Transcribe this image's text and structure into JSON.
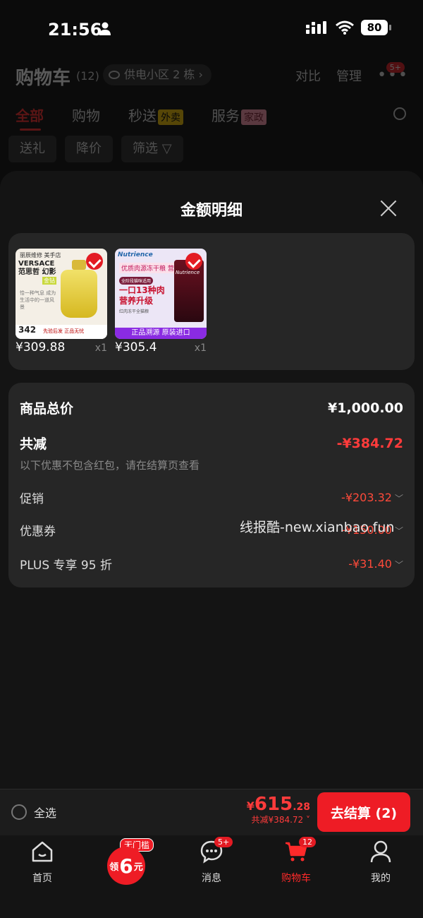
{
  "status": {
    "time": "21:56",
    "battery": "80"
  },
  "header": {
    "title": "购物车",
    "count": "(12)",
    "address": "供电小区 2 栋",
    "compare": "对比",
    "manage": "管理",
    "more_badge": "5+"
  },
  "category_tabs": {
    "all": "全部",
    "shopping": "购物",
    "express": "秒送",
    "express_tag": "外卖",
    "service": "服务",
    "service_tag": "家政"
  },
  "filters": {
    "gift": "送礼",
    "price_drop": "降价",
    "filter": "筛选"
  },
  "sheet": {
    "title": "金额明细",
    "products": [
      {
        "price": "¥309.88",
        "qty": "x1",
        "thumb_shop": "丽辰维修 美手店",
        "thumb_brand": "VERSACE 范思哲 幻影",
        "thumb_green": "金钻",
        "thumb_desc": "恰一种气息 成为生活中的一道风景",
        "thumb_bottom": "342",
        "thumb_bottom_small": "先验后发 正品无忧"
      },
      {
        "price": "¥305.4",
        "qty": "x1",
        "thumb_brand": "Nutrience",
        "thumb_line1": "优质肉源冻干粮 营养升",
        "thumb_mini": "全阶段猫咪适用",
        "thumb_big1": "一口13种肉",
        "thumb_big2": "营养升级",
        "thumb_small": "红肉冻干全猫粮",
        "thumb_bottom": "正品溯源 原装进口"
      }
    ],
    "details": {
      "total_label": "商品总价",
      "total_value": "¥1,000.00",
      "reduce_label": "共减",
      "reduce_value": "-¥384.72",
      "note": "以下优惠不包含红包，请在结算页查看",
      "promo_label": "促销",
      "promo_value": "-¥203.32",
      "coupon_label": "优惠券",
      "coupon_value": "-¥150.00",
      "plus_label": "PLUS 专享 95 折",
      "plus_value": "-¥31.40"
    },
    "watermark": "线报酷-new.xianbao.fun"
  },
  "checkout": {
    "select_all": "全选",
    "currency": "¥",
    "total_int": "615",
    "total_dec": ".28",
    "total_reduce": "共减¥384.72",
    "pay_button": "去结算 (2)"
  },
  "bottom_nav": {
    "home": "首页",
    "coupon_tag": "无门槛",
    "coupon_pre": "领",
    "coupon_num": "6",
    "coupon_post": "元",
    "messages": "消息",
    "messages_badge": "5+",
    "cart": "购物车",
    "cart_badge": "12",
    "me": "我的"
  },
  "colors": {
    "accent": "#ee1c25",
    "background": "#0b0b0b",
    "card": "#262626"
  }
}
